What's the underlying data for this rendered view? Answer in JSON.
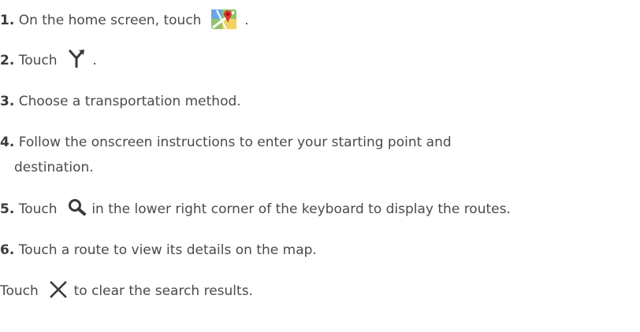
{
  "steps": [
    {
      "number": "1.",
      "text_before": "On the home screen, touch",
      "icon": "maps-app-icon",
      "text_after": "."
    },
    {
      "number": "2.",
      "text_before": "Touch",
      "icon": "directions-fork-icon",
      "text_after": "."
    },
    {
      "number": "3.",
      "text_before": "Choose a transportation method."
    },
    {
      "number": "4.",
      "text_before": "Follow the onscreen instructions to enter your starting point and",
      "text_line2": "destination."
    },
    {
      "number": "5.",
      "text_before": "Touch",
      "icon": "search-icon",
      "text_after": "in the lower right corner of the keyboard to display the routes."
    },
    {
      "number": "6.",
      "text_before": "Touch a route to view its details on the map."
    }
  ],
  "note": {
    "text_before": "Touch",
    "icon": "close-icon",
    "text_after": "to clear the search results."
  }
}
